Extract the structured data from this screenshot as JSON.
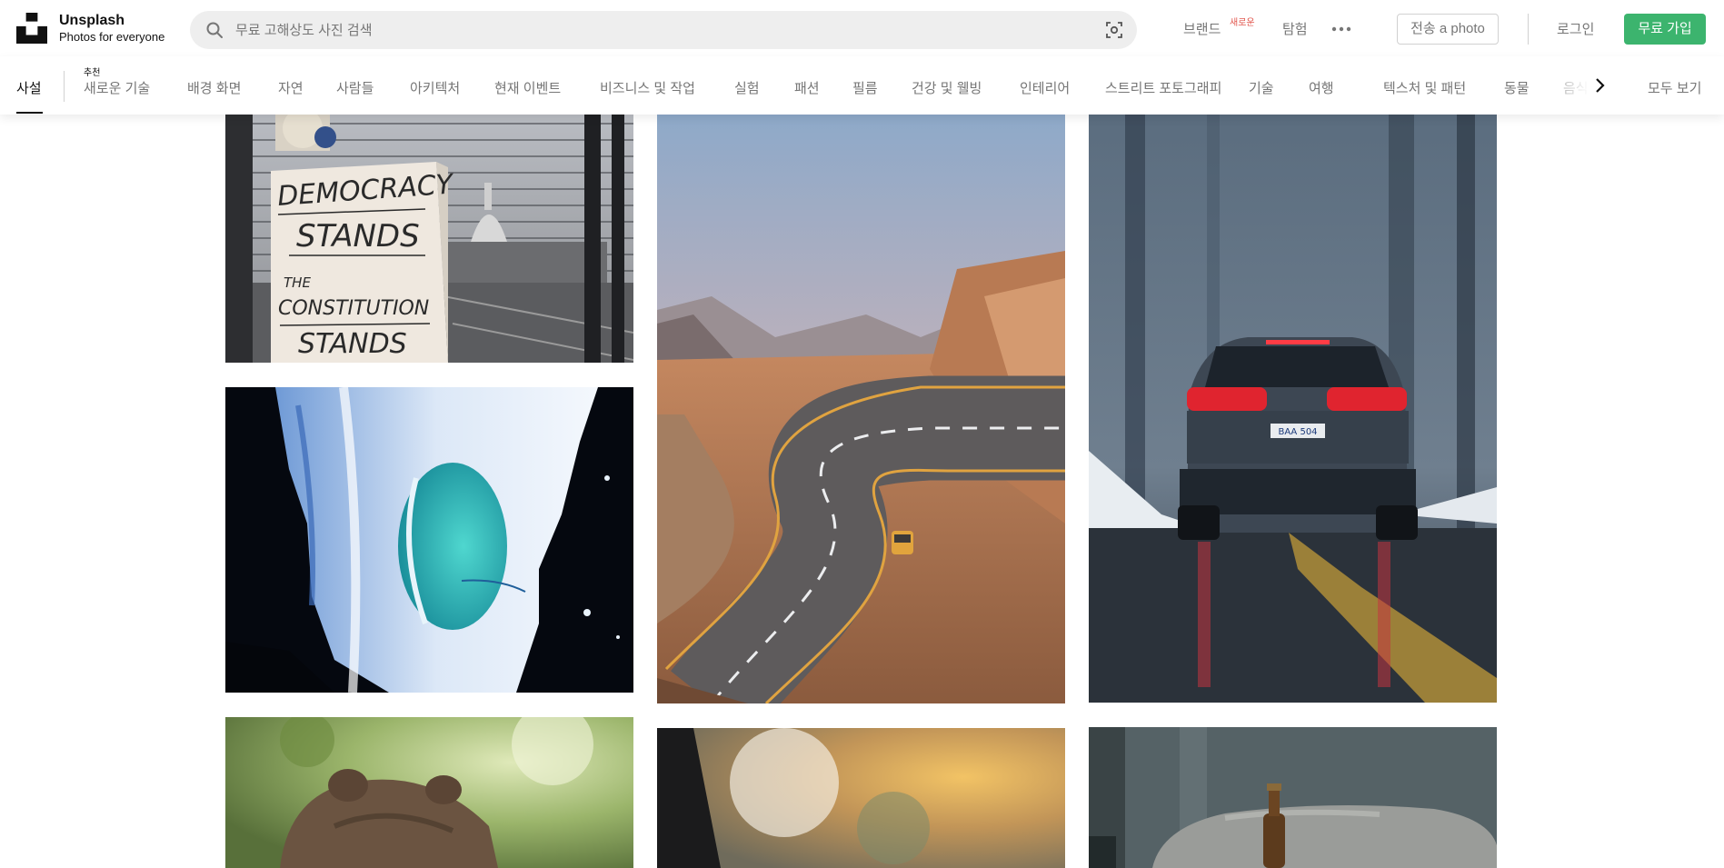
{
  "header": {
    "brand_name": "Unsplash",
    "brand_tagline": "Photos for everyone",
    "search_placeholder": "무료 고해상도 사진 검색",
    "nav": {
      "brands": "브랜드",
      "brands_badge": "새로운",
      "explore": "탐험"
    },
    "submit_label": "전송 a photo",
    "login_label": "로그인",
    "join_label": "무료 가입"
  },
  "tabs": {
    "recommended_caption": "추천",
    "items": [
      "사설",
      "새로운 기술",
      "배경 화면",
      "자연",
      "사람들",
      "아키텍처",
      "현재 이벤트",
      "비즈니스 및 작업",
      "실험",
      "패션",
      "필름",
      "건강 및 웰빙",
      "인테리어",
      "스트리트 포토그래피",
      "기술",
      "여행",
      "텍스처 및 패턴",
      "동물",
      "음식"
    ],
    "all_label": "모두 보기"
  },
  "photos": {
    "sign_lines": [
      "DEMOCRACY",
      "STANDS",
      "THE",
      "CONSTITUTION",
      "STANDS"
    ],
    "plate": "BAA 504"
  },
  "colors": {
    "accent": "#3cb46e",
    "badge": "#e25950",
    "muted_text": "#767676"
  },
  "icons": [
    "logo-icon",
    "search-icon",
    "visual-search-icon",
    "more-icon",
    "chevron-right-icon"
  ]
}
